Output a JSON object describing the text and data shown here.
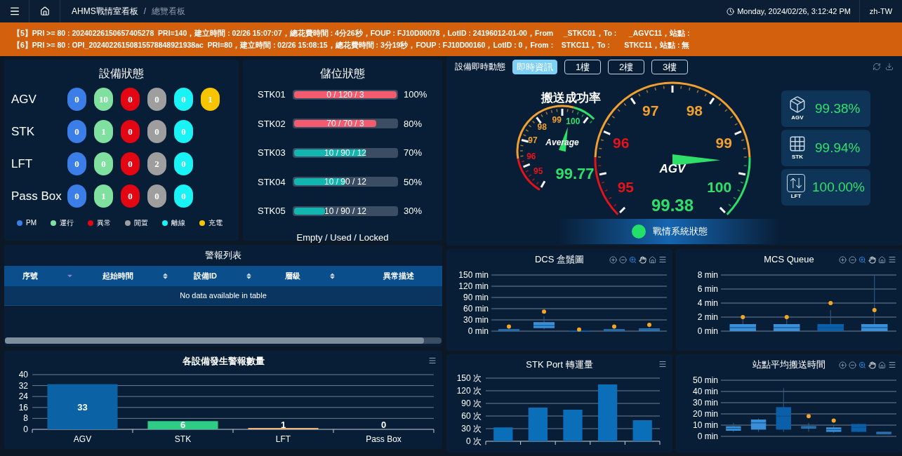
{
  "header": {
    "breadcrumb": {
      "items": [
        "AHMS戰情室看板",
        "總覽看板"
      ],
      "separator": "/"
    },
    "datetime": "Monday, 2024/02/26, 3:12:42 PM",
    "language": "zh-TW"
  },
  "banner": {
    "lines": [
      "【5】PRI >= 80 : 20240226150657405278  PRI=140，建立時間 : 02/26 15:07:07，總花費時間 : 4分26秒，FOUP : FJ10D00078，LotID : 24196012-01-00，From     _STKC01，To :      _AGVC11，站點 :",
      "【6】PRI >= 80 : OPI_20240226150815578848921938ac  PRI=80，建立時間 : 02/26 15:08:15，總花費時間 : 3分19秒，FOUP : FJ10D00160，LotID : 0，From :    STKC11，To :       STKC11，站點 : 無"
    ]
  },
  "equipment_status": {
    "title": "設備狀態",
    "rows": [
      {
        "name": "AGV",
        "counts": [
          "0",
          "10",
          "0",
          "0",
          "0",
          "1"
        ]
      },
      {
        "name": "STK",
        "counts": [
          "0",
          "1",
          "0",
          "0",
          "0"
        ]
      },
      {
        "name": "LFT",
        "counts": [
          "0",
          "0",
          "0",
          "2",
          "0"
        ]
      },
      {
        "name": "Pass Box",
        "counts": [
          "0",
          "1",
          "0",
          "0",
          "0"
        ]
      }
    ],
    "legend": [
      {
        "label": "PM",
        "color": "#3b7ee8"
      },
      {
        "label": "運行",
        "color": "#7fe0a0"
      },
      {
        "label": "異常",
        "color": "#e30613"
      },
      {
        "label": "閒置",
        "color": "#9e9e9e"
      },
      {
        "label": "離線",
        "color": "#19f3f5"
      },
      {
        "label": "充電",
        "color": "#f7c500"
      }
    ]
  },
  "storage": {
    "title": "儲位狀態",
    "rows": [
      {
        "name": "STK01",
        "label": "0 / 120 / 3",
        "level": 1,
        "percent": "100%",
        "color": "#f25c6e"
      },
      {
        "name": "STK02",
        "label": "70 / 70 / 3",
        "level": 0.8,
        "percent": "80%",
        "color": "#f25c6e"
      },
      {
        "name": "STK03",
        "label": "10 / 90 / 12",
        "level": 0.7,
        "percent": "70%",
        "color": "#13b5b1"
      },
      {
        "name": "STK04",
        "label": "10 / 90 / 12",
        "level": 0.5,
        "percent": "50%",
        "color": "#13b5b1"
      },
      {
        "name": "STK05",
        "label": "10 / 90 / 12",
        "level": 0.3,
        "percent": "30%",
        "color": "#13b5b1"
      }
    ],
    "footer": "Empty / Used / Locked"
  },
  "realtime": {
    "title": "設備即時動態",
    "tabs": [
      {
        "label": "即時資訊",
        "selected": true
      },
      {
        "label": "1樓",
        "selected": false
      },
      {
        "label": "2樓",
        "selected": false
      },
      {
        "label": "3樓",
        "selected": false
      }
    ],
    "heading": "搬送成功率",
    "gauges": [
      {
        "kind": "small",
        "name": "Average",
        "labels": [
          "95",
          "96",
          "97",
          "98",
          "99",
          "100"
        ],
        "value": "99.77"
      },
      {
        "kind": "large",
        "name": "AGV",
        "labels": [
          "95",
          "96",
          "97",
          "98",
          "99",
          "100"
        ],
        "value": "99.38"
      }
    ],
    "cards": [
      {
        "kind": "agv",
        "label": "AGV",
        "value": "99.38%"
      },
      {
        "kind": "stk",
        "label": "STK",
        "value": "99.94%"
      },
      {
        "kind": "lft",
        "label": "LFT",
        "value": "100.00%"
      }
    ],
    "status": {
      "label": "戰情系統狀態",
      "color": "#22e06a"
    }
  },
  "alarms": {
    "title": "警報列表",
    "columns": [
      {
        "label": "序號",
        "kind": "descending"
      },
      {
        "label": "起始時間",
        "kind": "sortable"
      },
      {
        "label": "設備ID",
        "kind": "sortable"
      },
      {
        "label": "層級",
        "kind": "sortable"
      },
      {
        "label": "異常描述",
        "kind": "plain"
      }
    ],
    "empty_message": "No data available in table"
  },
  "alarm_count": {
    "title": "各設備發生警報數量",
    "zoom_tools": false,
    "chart_data": {
      "type": "bar",
      "categories": [
        "AGV",
        "STK",
        "LFT",
        "Pass Box"
      ],
      "stacked": true,
      "grid": true,
      "ylim": [
        0,
        40
      ],
      "yticks": [
        0,
        8,
        16,
        24,
        32,
        40
      ],
      "data_labels": true,
      "series": [
        {
          "color": "#0b62a4",
          "values": [
            33,
            null,
            null,
            null
          ]
        },
        {
          "color": "#2ecc85",
          "values": [
            null,
            6,
            null,
            null
          ]
        },
        {
          "color": "#f5b97a",
          "values": [
            null,
            null,
            1,
            null
          ]
        },
        {
          "color": "#7cb5ec",
          "values": [
            null,
            null,
            null,
            0
          ]
        }
      ]
    }
  },
  "box_charts": [
    {
      "kind": "dcs",
      "title": "DCS 盒鬚圖",
      "zoom_tools": true,
      "y_labels": [
        "150 min",
        "120 min",
        "90 min",
        "60 min",
        "30 min",
        "0 min"
      ]
    },
    {
      "kind": "mcs",
      "title": "MCS Queue",
      "zoom_tools": true,
      "y_labels": [
        "8 min",
        "6 min",
        "4 min",
        "2 min",
        "0 min"
      ]
    }
  ],
  "stk_port": {
    "title": "STK Port 轉運量",
    "zoom_tools": false,
    "chart_data": {
      "type": "bar",
      "grid": true,
      "ylim": [
        0,
        150
      ],
      "yticks": [
        {
          "value": 0,
          "label": "0 次"
        },
        {
          "value": 30,
          "label": "30 次"
        },
        {
          "value": 60,
          "label": "60 次"
        },
        {
          "value": 90,
          "label": "90 次"
        },
        {
          "value": 120,
          "label": "120 次"
        },
        {
          "value": 150,
          "label": "150 次"
        }
      ],
      "series": [
        {
          "color": "#0a6fb8",
          "values": [
            33,
            80,
            75,
            135,
            50
          ]
        }
      ]
    }
  },
  "station_chart": {
    "kind": "station",
    "title": "站點平均搬送時間",
    "zoom_tools": true,
    "y_labels": [
      "50 min",
      "40 min",
      "30 min",
      "20 min",
      "10 min",
      "0 min"
    ]
  }
}
